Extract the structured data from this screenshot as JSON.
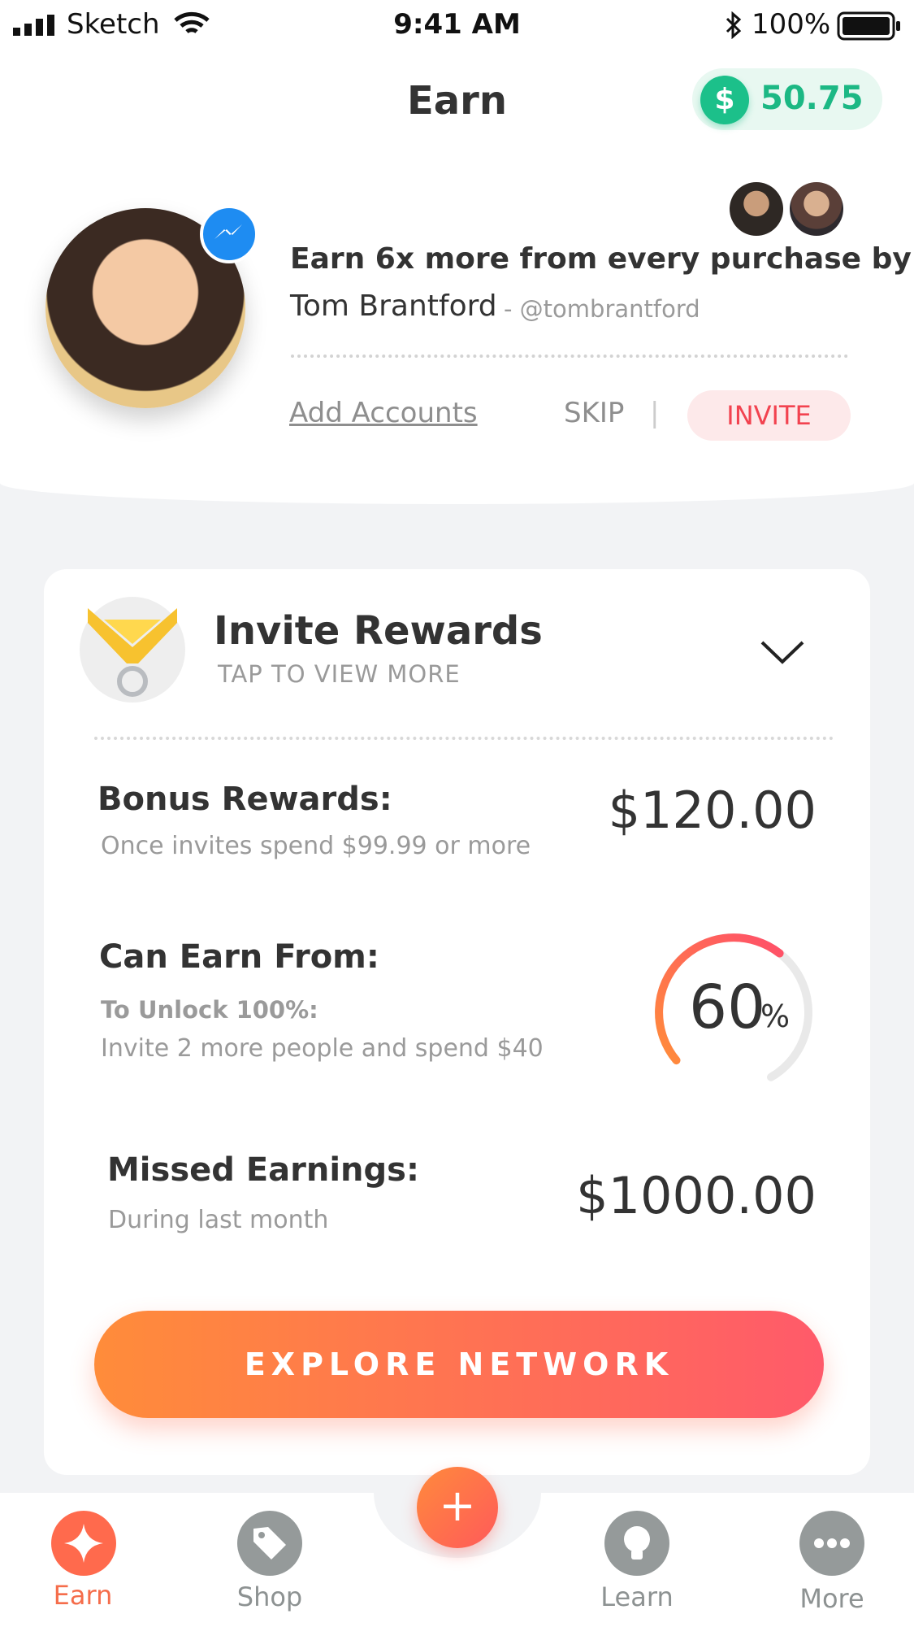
{
  "status_bar": {
    "carrier": "Sketch",
    "time": "9:41 AM",
    "battery": "100%"
  },
  "header": {
    "title": "Earn",
    "balance_symbol": "$",
    "balance": "50.75"
  },
  "profile": {
    "headline": "Earn 6x more from every purchase by:",
    "name": "Tom Brantford",
    "handle": "- @tombrantford",
    "add_accounts": "Add Accounts",
    "skip": "SKIP",
    "separator": "|",
    "invite": "INVITE"
  },
  "rewards_card": {
    "title": "Invite Rewards",
    "subtitle": "TAP TO VIEW MORE",
    "bonus": {
      "label": "Bonus Rewards:",
      "desc": "Once invites spend $99.99 or more",
      "amount": "$120.00"
    },
    "can_earn": {
      "label": "Can Earn From:",
      "unlock_label": "To Unlock 100%:",
      "unlock_desc": "Invite 2 more people and spend $40",
      "percent": "60",
      "unit": "%",
      "progress": 0.6
    },
    "missed": {
      "label": "Missed Earnings:",
      "desc": "During last month",
      "amount": "$1000.00"
    },
    "explore_button": "EXPLORE NETWORK"
  },
  "tab_bar": {
    "add": "+",
    "tabs": [
      {
        "label": "Earn",
        "icon": "sparkle-icon",
        "active": true
      },
      {
        "label": "Shop",
        "icon": "tag-icon",
        "active": false
      },
      {
        "label": "Learn",
        "icon": "lightbulb-icon",
        "active": false
      },
      {
        "label": "More",
        "icon": "more-dots-icon",
        "active": false
      }
    ]
  },
  "colors": {
    "accent": "#ff6a4d",
    "balance_green": "#1cb884",
    "invite_red": "#f2424f"
  }
}
